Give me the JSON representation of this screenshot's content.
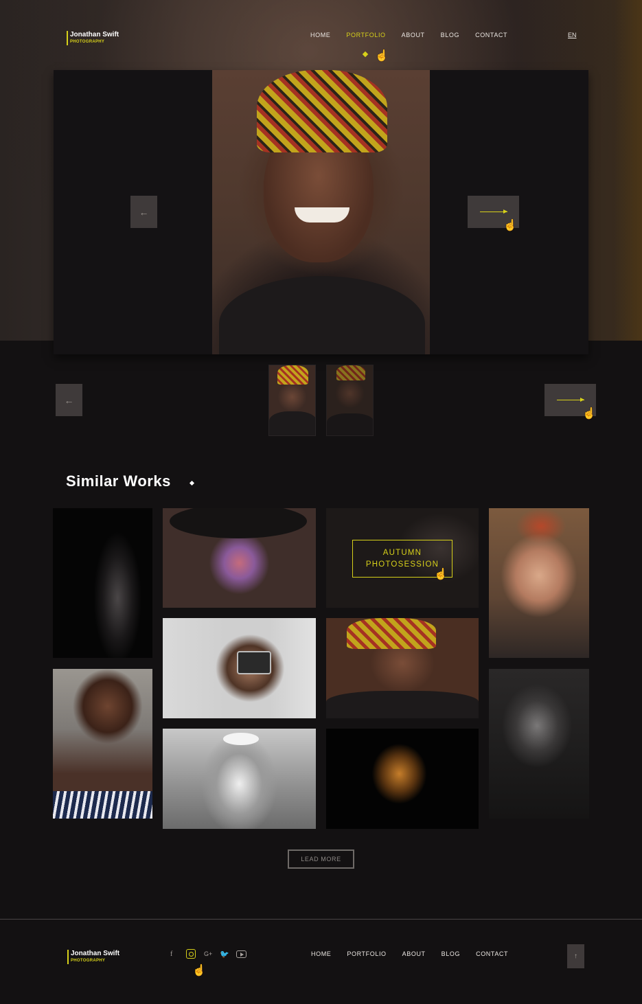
{
  "brand": {
    "name": "Jonathan Swift",
    "tagline": "PHOTOGRAPHY",
    "accent": "#d7d11a"
  },
  "nav": {
    "items": [
      "HOME",
      "PORTFOLIO",
      "ABOUT",
      "BLOG",
      "CONTACT"
    ],
    "active": "PORTFOLIO",
    "language": "EN"
  },
  "slider": {
    "prev_icon": "arrow-left-icon",
    "next_icon": "arrow-right-icon"
  },
  "thumbnails": {
    "prev_icon": "arrow-left-icon",
    "next_icon": "arrow-right-icon",
    "count": 2
  },
  "similar_works": {
    "title": "Similar Works",
    "overlay_line1": "AUTUMN",
    "overlay_line2": "PHOTOSESSION",
    "load_more": "LEAD MORE"
  },
  "footer": {
    "brand_name": "Jonathan Swift",
    "brand_tagline": "PHOTOGRAPHY",
    "social_icons": [
      "facebook-icon",
      "instagram-icon",
      "google-plus-icon",
      "twitter-icon",
      "youtube-icon"
    ],
    "nav": [
      "HOME",
      "PORTFOLIO",
      "ABOUT",
      "BLOG",
      "CONTACT"
    ],
    "back_to_top_icon": "arrow-up-icon"
  },
  "glyphs": {
    "left": "←",
    "up": "↑",
    "facebook": "f",
    "gplus": "G+",
    "twitter": "🐦",
    "pointer": "☝"
  }
}
